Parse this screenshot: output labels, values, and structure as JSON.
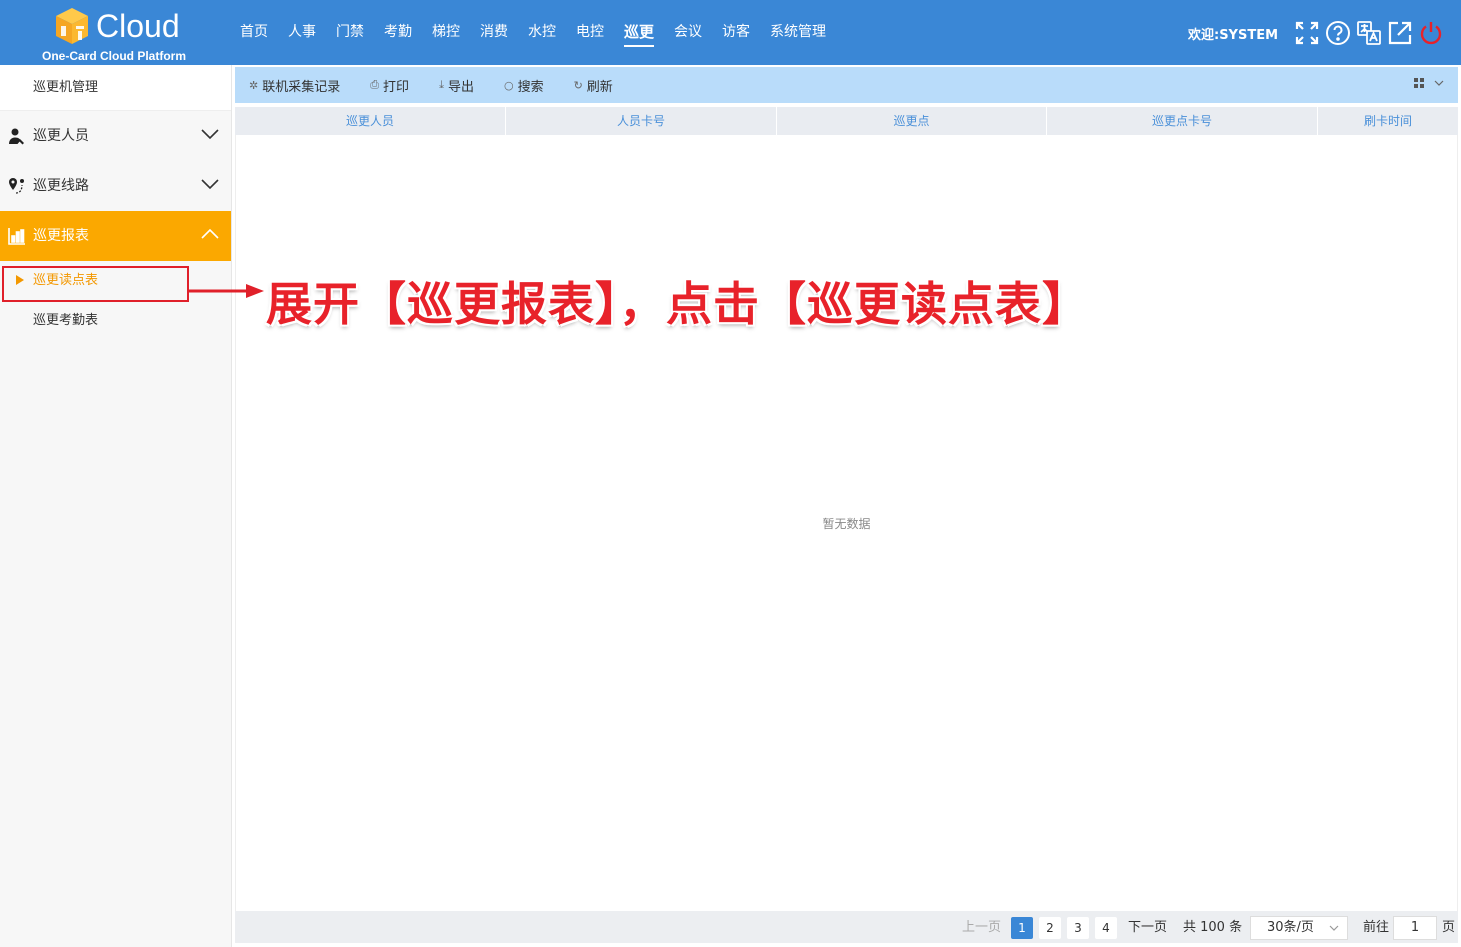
{
  "header": {
    "logo_text": "Cloud",
    "logo_subtitle": "One-Card Cloud Platform",
    "nav": [
      "首页",
      "人事",
      "门禁",
      "考勤",
      "梯控",
      "消费",
      "水控",
      "电控",
      "巡更",
      "会议",
      "访客",
      "系统管理"
    ],
    "active_nav_index": 8,
    "welcome": "欢迎:SYSTEM",
    "icons": [
      "fullscreen-icon",
      "help-icon",
      "language-icon",
      "external-link-icon",
      "power-icon"
    ],
    "colors": {
      "bar": "#3a87d6",
      "power": "#e8222a"
    }
  },
  "sidebar": {
    "top_item": "巡更机管理",
    "groups": [
      {
        "label": "巡更人员",
        "icon": "person-icon",
        "open": false
      },
      {
        "label": "巡更线路",
        "icon": "route-pin-icon",
        "open": false
      },
      {
        "label": "巡更报表",
        "icon": "bar-chart-icon",
        "open": true
      }
    ],
    "sub_items": [
      {
        "label": "巡更读点表",
        "active": true
      },
      {
        "label": "巡更考勤表",
        "active": false
      }
    ],
    "colors": {
      "open_group": "#fba800",
      "active_sub": "#f39800"
    }
  },
  "toolbar": {
    "buttons": [
      {
        "label": "联机采集记录",
        "icon": "collect-icon"
      },
      {
        "label": "打印",
        "icon": "print-icon"
      },
      {
        "label": "导出",
        "icon": "download-icon"
      },
      {
        "label": "搜索",
        "icon": "search-icon"
      },
      {
        "label": "刷新",
        "icon": "refresh-icon"
      }
    ]
  },
  "table": {
    "columns": [
      "巡更人员",
      "人员卡号",
      "巡更点",
      "巡更点卡号",
      "刷卡时间"
    ],
    "empty_text": "暂无数据"
  },
  "pagination": {
    "prev": "上一页",
    "pages": [
      "1",
      "2",
      "3",
      "4"
    ],
    "current": "1",
    "next": "下一页",
    "total": "共 100 条",
    "page_size": "30条/页",
    "goto_label": "前往",
    "goto_value": "1",
    "page_unit": "页"
  },
  "annotation": {
    "text": "展开【巡更报表】，点击【巡更读点表】",
    "color": "#e8222a"
  }
}
